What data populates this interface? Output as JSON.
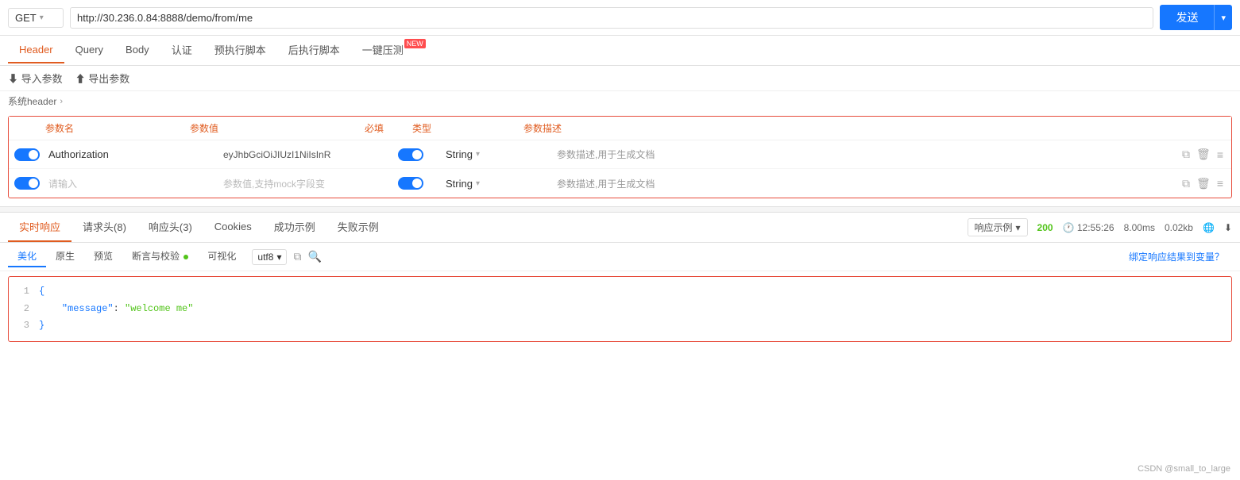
{
  "url_bar": {
    "method": "GET",
    "url": "http://30.236.0.84:8888/demo/from/me",
    "send_label": "发送"
  },
  "tabs": [
    {
      "label": "Header",
      "active": true
    },
    {
      "label": "Query",
      "active": false
    },
    {
      "label": "Body",
      "active": false
    },
    {
      "label": "认证",
      "active": false
    },
    {
      "label": "预执行脚本",
      "active": false
    },
    {
      "label": "后执行脚本",
      "active": false
    },
    {
      "label": "一键压测",
      "active": false,
      "badge": "NEW"
    }
  ],
  "toolbar": {
    "import_label": "⬇ 导入参数",
    "export_label": "⬆ 导出参数"
  },
  "breadcrumb": {
    "label": "系统header",
    "chevron": "›"
  },
  "params_table": {
    "headers": {
      "name": "参数名",
      "value": "参数值",
      "required": "必填",
      "type": "类型",
      "description": "参数描述"
    },
    "rows": [
      {
        "enabled": true,
        "name": "Authorization",
        "value": "eyJhbGciOiJIUzI1NiIsInR",
        "required": true,
        "type": "String",
        "description": "参数描述,用于生成文档"
      },
      {
        "enabled": true,
        "name_placeholder": "请输入",
        "value_placeholder": "参数值,支持mock字段变",
        "required": true,
        "type": "String",
        "description": "参数描述,用于生成文档"
      }
    ]
  },
  "response_tabs": [
    {
      "label": "实时响应",
      "active": true
    },
    {
      "label": "请求头(8)",
      "active": false
    },
    {
      "label": "响应头(3)",
      "active": false
    },
    {
      "label": "Cookies",
      "active": false
    },
    {
      "label": "成功示例",
      "active": false
    },
    {
      "label": "失败示例",
      "active": false
    }
  ],
  "response_meta": {
    "example_btn": "响应示例",
    "status": "200",
    "time_icon": "🕐",
    "time": "12:55:26",
    "duration": "8.00ms",
    "size": "0.02kb",
    "globe_icon": "🌐",
    "download_icon": "⬇"
  },
  "format_tabs": [
    {
      "label": "美化",
      "active": true
    },
    {
      "label": "原生",
      "active": false
    },
    {
      "label": "预览",
      "active": false
    },
    {
      "label": "断言与校验",
      "active": false,
      "has_dot": true
    },
    {
      "label": "可视化",
      "active": false
    }
  ],
  "encoding": "utf8",
  "response_code": {
    "lines": [
      {
        "num": "1",
        "content": "{"
      },
      {
        "num": "2",
        "content": "    \"message\": \"welcome me\""
      },
      {
        "num": "3",
        "content": "}"
      }
    ]
  },
  "bind_response": "绑定响应结果到变量？",
  "footer": "CSDN @small_to_large"
}
